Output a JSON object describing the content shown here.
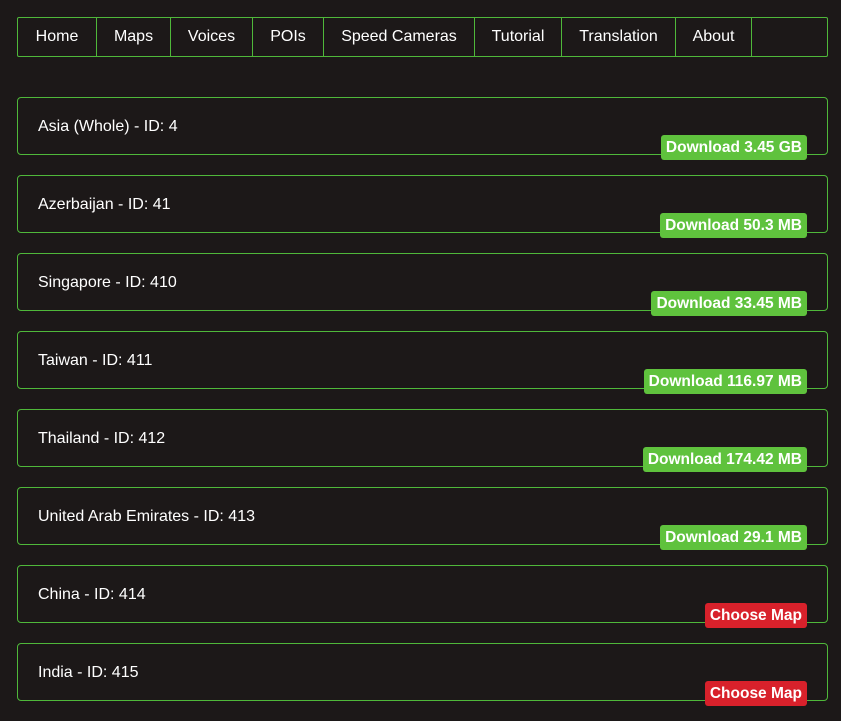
{
  "nav": {
    "items": [
      {
        "label": "Home"
      },
      {
        "label": "Maps"
      },
      {
        "label": "Voices"
      },
      {
        "label": "POIs"
      },
      {
        "label": "Speed Cameras"
      },
      {
        "label": "Tutorial"
      },
      {
        "label": "Translation"
      },
      {
        "label": "About"
      }
    ]
  },
  "colors": {
    "background": "#1c1818",
    "border": "#4fb83a",
    "download": "#5fc23d",
    "choose": "#d8212b",
    "text": "#ffffff"
  },
  "maps": [
    {
      "title": "Asia (Whole) - ID: 4",
      "button": "Download 3.45 GB",
      "type": "download"
    },
    {
      "title": "Azerbaijan - ID: 41",
      "button": "Download 50.3 MB",
      "type": "download"
    },
    {
      "title": "Singapore - ID: 410",
      "button": "Download 33.45 MB",
      "type": "download"
    },
    {
      "title": "Taiwan - ID: 411",
      "button": "Download 116.97 MB",
      "type": "download"
    },
    {
      "title": "Thailand - ID: 412",
      "button": "Download 174.42 MB",
      "type": "download"
    },
    {
      "title": "United Arab Emirates - ID: 413",
      "button": "Download 29.1 MB",
      "type": "download"
    },
    {
      "title": "China - ID: 414",
      "button": "Choose Map",
      "type": "choose"
    },
    {
      "title": "India - ID: 415",
      "button": "Choose Map",
      "type": "choose"
    }
  ]
}
